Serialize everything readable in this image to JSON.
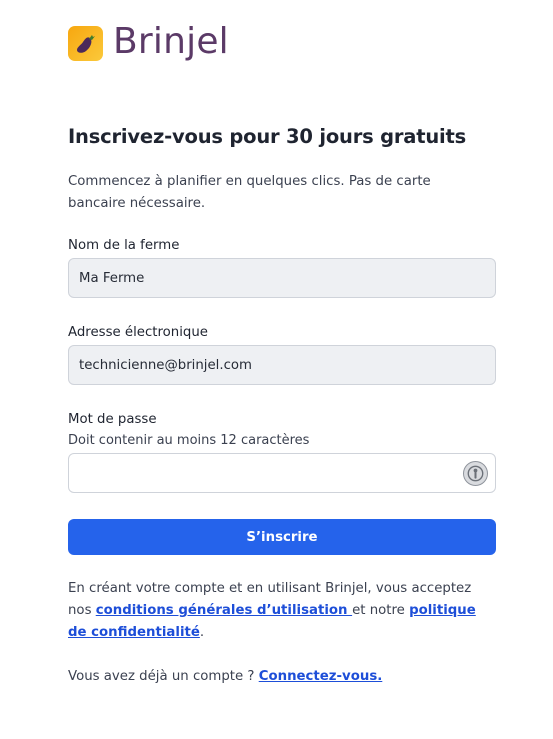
{
  "brand": {
    "name": "Brinjel",
    "logo_icon": "eggplant-icon",
    "logo_color": "#5b3a67"
  },
  "heading": {
    "title": "Inscrivez-vous pour 30 jours gratuits",
    "subtitle": "Commencez à planifier en quelques clics. Pas de carte bancaire nécessaire."
  },
  "form": {
    "farm_name": {
      "label": "Nom de la ferme",
      "value": "Ma Ferme"
    },
    "email": {
      "label": "Adresse électronique",
      "value": "technicienne@brinjel.com"
    },
    "password": {
      "label": "Mot de passe",
      "hint": "Doit contenir au moins 12 caractères",
      "value": ""
    },
    "submit_label": "S’inscrire"
  },
  "legal": {
    "prefix": "En créant votre compte et en utilisant Brinjel, vous acceptez nos ",
    "terms_link": "conditions générales d’utilisation ",
    "middle": "et notre ",
    "privacy_link": "politique de confidentialité",
    "suffix": "."
  },
  "login": {
    "prompt": "Vous avez déjà un compte ? ",
    "link": "Connectez-vous."
  },
  "colors": {
    "accent": "#2563eb",
    "link": "#1d4ed8",
    "logo_bg": "#f7a70f"
  }
}
